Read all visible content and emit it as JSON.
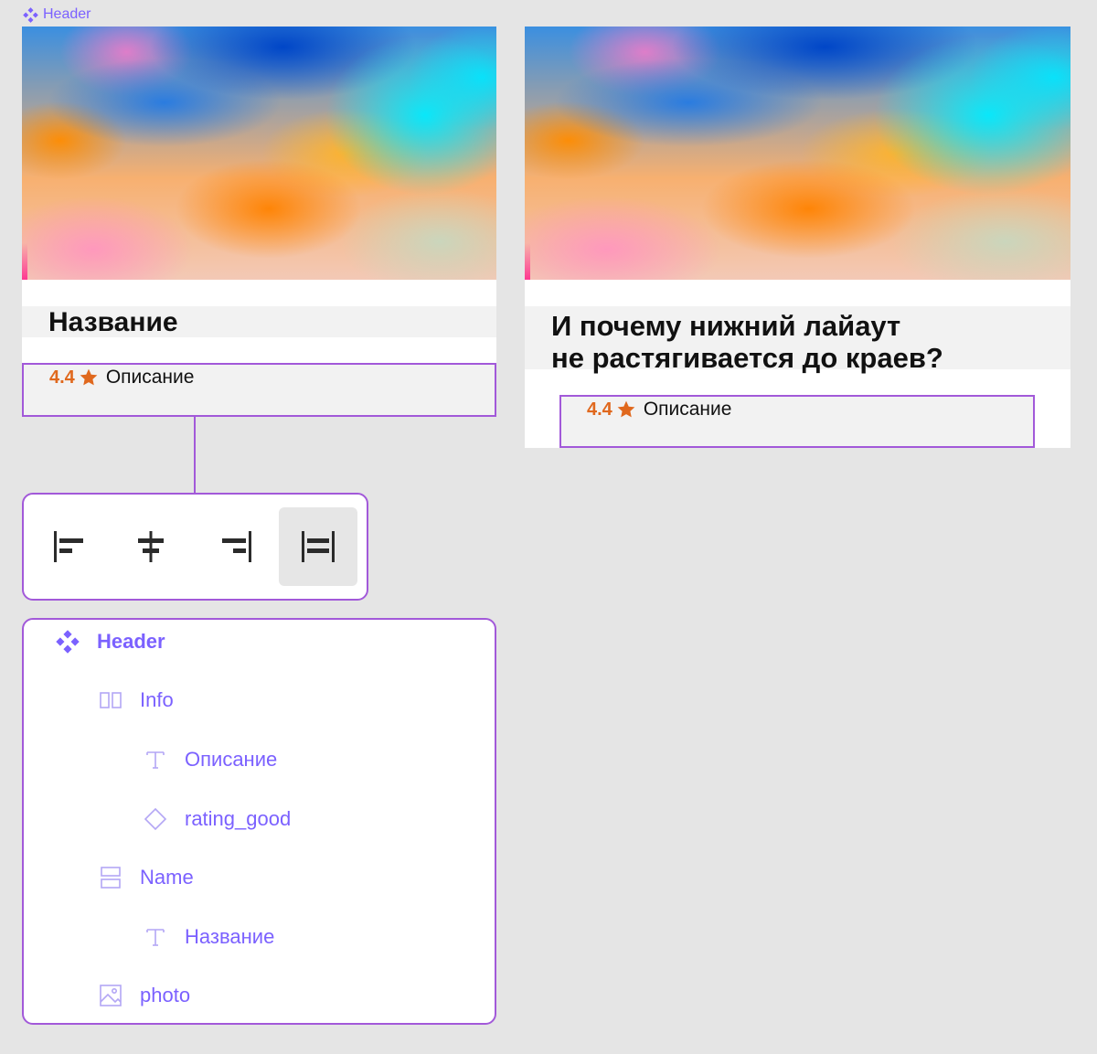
{
  "frame": {
    "label": "Header"
  },
  "card_left": {
    "name": "Название",
    "rating": "4.4",
    "description": "Описание"
  },
  "card_right": {
    "name_line1": "И почему нижний лайаут",
    "name_line2": "не растягивается до краев?",
    "rating": "4.4",
    "description": "Описание"
  },
  "alignment": {
    "options": [
      "align-left",
      "align-center",
      "align-right",
      "align-stretch"
    ],
    "active": "align-stretch"
  },
  "layers": [
    {
      "label": "Header",
      "icon": "component-icon",
      "depth": 0
    },
    {
      "label": "Info",
      "icon": "auto-layout-horizontal-icon",
      "depth": 1
    },
    {
      "label": "Описание",
      "icon": "text-icon",
      "depth": 2
    },
    {
      "label": "rating_good",
      "icon": "instance-icon",
      "depth": 2
    },
    {
      "label": "Name",
      "icon": "auto-layout-vertical-icon",
      "depth": 1
    },
    {
      "label": "Название",
      "icon": "text-icon",
      "depth": 2
    },
    {
      "label": "photo",
      "icon": "image-icon",
      "depth": 1
    }
  ],
  "colors": {
    "accent": "#7b61ff",
    "selection": "#a259d9",
    "rating": "#e0681d"
  }
}
